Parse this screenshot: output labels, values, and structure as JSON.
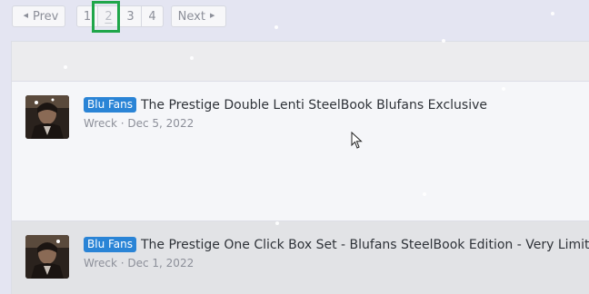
{
  "pagination": {
    "prev_label": "Prev",
    "next_label": "Next",
    "pages": [
      "1",
      "2",
      "3",
      "4"
    ],
    "current_page": "2"
  },
  "threads": [
    {
      "badge": "Blu Fans",
      "title": "The Prestige Double Lenti SteelBook Blufans Exclusive",
      "meta": "Wreck · Dec 5, 2022"
    },
    {
      "badge": "Blu Fans",
      "title": "The Prestige One Click Box Set - Blufans SteelBook Edition - Very Limited",
      "meta": "Wreck · Dec 1, 2022"
    }
  ],
  "colors": {
    "badge": "#2a84d6",
    "highlight": "#1fa64a",
    "background": "#e4e5f2"
  }
}
